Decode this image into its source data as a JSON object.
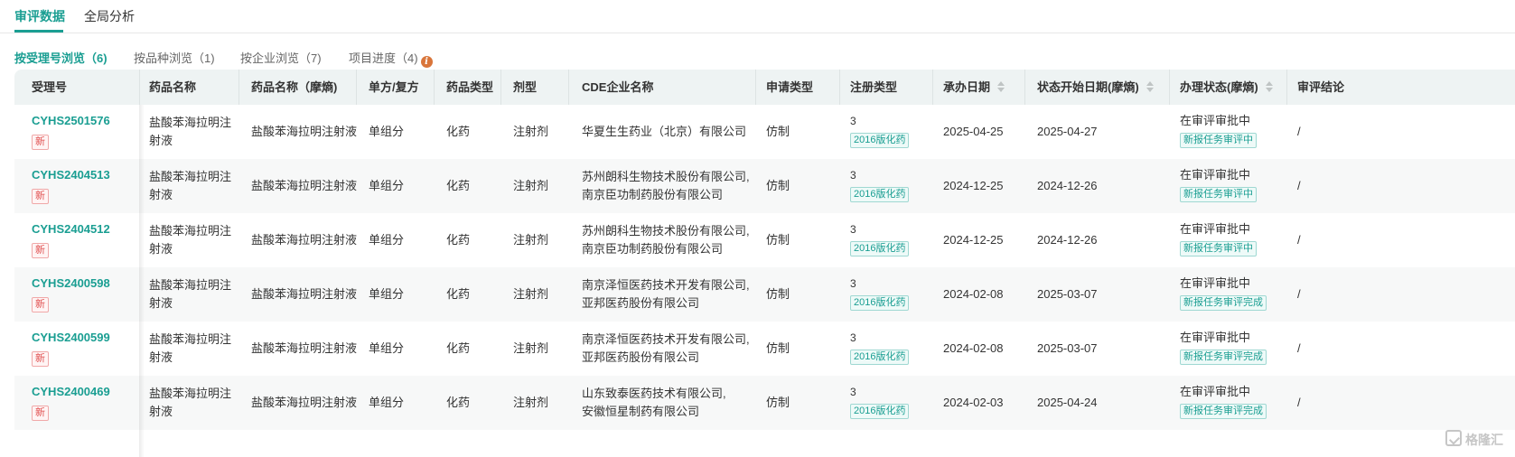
{
  "top_tabs": [
    {
      "label": "审评数据",
      "active": true
    },
    {
      "label": "全局分析",
      "active": false
    }
  ],
  "sub_tabs": [
    {
      "label": "按受理号浏览（6)",
      "active": true
    },
    {
      "label": "按品种浏览（1)",
      "active": false
    },
    {
      "label": "按企业浏览（7)",
      "active": false
    },
    {
      "label": "项目进度（4)",
      "active": false,
      "info_icon": "info-icon"
    }
  ],
  "columns": [
    "受理号",
    "药品名称",
    "药品名称（摩熵)",
    "单方/复方",
    "药品类型",
    "剂型",
    "CDE企业名称",
    "申请类型",
    "注册类型",
    "承办日期",
    "状态开始日期(摩熵)",
    "办理状态(摩熵)",
    "审评结论"
  ],
  "sortable_icon": "sort-caret-icon",
  "rows": [
    {
      "id": "CYHS2501576",
      "badge": "新",
      "drug_name": [
        "盐酸苯海拉明注",
        "射液"
      ],
      "drug_name_ms": "盐酸苯海拉明注射液",
      "formula": "单组分",
      "drug_type": "化药",
      "dosage": "注射剂",
      "company": [
        "华夏生生药业（北京）有限公司"
      ],
      "apply_type": "仿制",
      "reg_type": "3",
      "reg_tag": "2016版化药",
      "accept_date": "2025-04-25",
      "status_date": "2025-04-27",
      "status": "在审评审批中",
      "status_tag": "新报任务审评中",
      "conclusion": "/"
    },
    {
      "id": "CYHS2404513",
      "badge": "新",
      "drug_name": [
        "盐酸苯海拉明注",
        "射液"
      ],
      "drug_name_ms": "盐酸苯海拉明注射液",
      "formula": "单组分",
      "drug_type": "化药",
      "dosage": "注射剂",
      "company": [
        "苏州朗科生物技术股份有限公司,",
        "南京臣功制药股份有限公司"
      ],
      "apply_type": "仿制",
      "reg_type": "3",
      "reg_tag": "2016版化药",
      "accept_date": "2024-12-25",
      "status_date": "2024-12-26",
      "status": "在审评审批中",
      "status_tag": "新报任务审评中",
      "conclusion": "/"
    },
    {
      "id": "CYHS2404512",
      "badge": "新",
      "drug_name": [
        "盐酸苯海拉明注",
        "射液"
      ],
      "drug_name_ms": "盐酸苯海拉明注射液",
      "formula": "单组分",
      "drug_type": "化药",
      "dosage": "注射剂",
      "company": [
        "苏州朗科生物技术股份有限公司,",
        "南京臣功制药股份有限公司"
      ],
      "apply_type": "仿制",
      "reg_type": "3",
      "reg_tag": "2016版化药",
      "accept_date": "2024-12-25",
      "status_date": "2024-12-26",
      "status": "在审评审批中",
      "status_tag": "新报任务审评中",
      "conclusion": "/"
    },
    {
      "id": "CYHS2400598",
      "badge": "新",
      "drug_name": [
        "盐酸苯海拉明注",
        "射液"
      ],
      "drug_name_ms": "盐酸苯海拉明注射液",
      "formula": "单组分",
      "drug_type": "化药",
      "dosage": "注射剂",
      "company": [
        "南京泽恒医药技术开发有限公司,",
        "亚邦医药股份有限公司"
      ],
      "apply_type": "仿制",
      "reg_type": "3",
      "reg_tag": "2016版化药",
      "accept_date": "2024-02-08",
      "status_date": "2025-03-07",
      "status": "在审评审批中",
      "status_tag": "新报任务审评完成",
      "conclusion": "/"
    },
    {
      "id": "CYHS2400599",
      "badge": "新",
      "drug_name": [
        "盐酸苯海拉明注",
        "射液"
      ],
      "drug_name_ms": "盐酸苯海拉明注射液",
      "formula": "单组分",
      "drug_type": "化药",
      "dosage": "注射剂",
      "company": [
        "南京泽恒医药技术开发有限公司,",
        "亚邦医药股份有限公司"
      ],
      "apply_type": "仿制",
      "reg_type": "3",
      "reg_tag": "2016版化药",
      "accept_date": "2024-02-08",
      "status_date": "2025-03-07",
      "status": "在审评审批中",
      "status_tag": "新报任务审评完成",
      "conclusion": "/"
    },
    {
      "id": "CYHS2400469",
      "badge": "新",
      "drug_name": [
        "盐酸苯海拉明注",
        "射液"
      ],
      "drug_name_ms": "盐酸苯海拉明注射液",
      "formula": "单组分",
      "drug_type": "化药",
      "dosage": "注射剂",
      "company": [
        "山东致泰医药技术有限公司,",
        "安徽恒星制药有限公司"
      ],
      "apply_type": "仿制",
      "reg_type": "3",
      "reg_tag": "2016版化药",
      "accept_date": "2024-02-03",
      "status_date": "2025-04-24",
      "status": "在审评审批中",
      "status_tag": "新报任务审评完成",
      "conclusion": "/"
    }
  ],
  "watermark": {
    "text": "格隆汇",
    "icon": "checkmark-box-icon"
  },
  "colors": {
    "accent": "#1a9e92",
    "new_badge": "#e05050",
    "info_icon": "#d9753a",
    "header_bg": "#eef3f3"
  }
}
